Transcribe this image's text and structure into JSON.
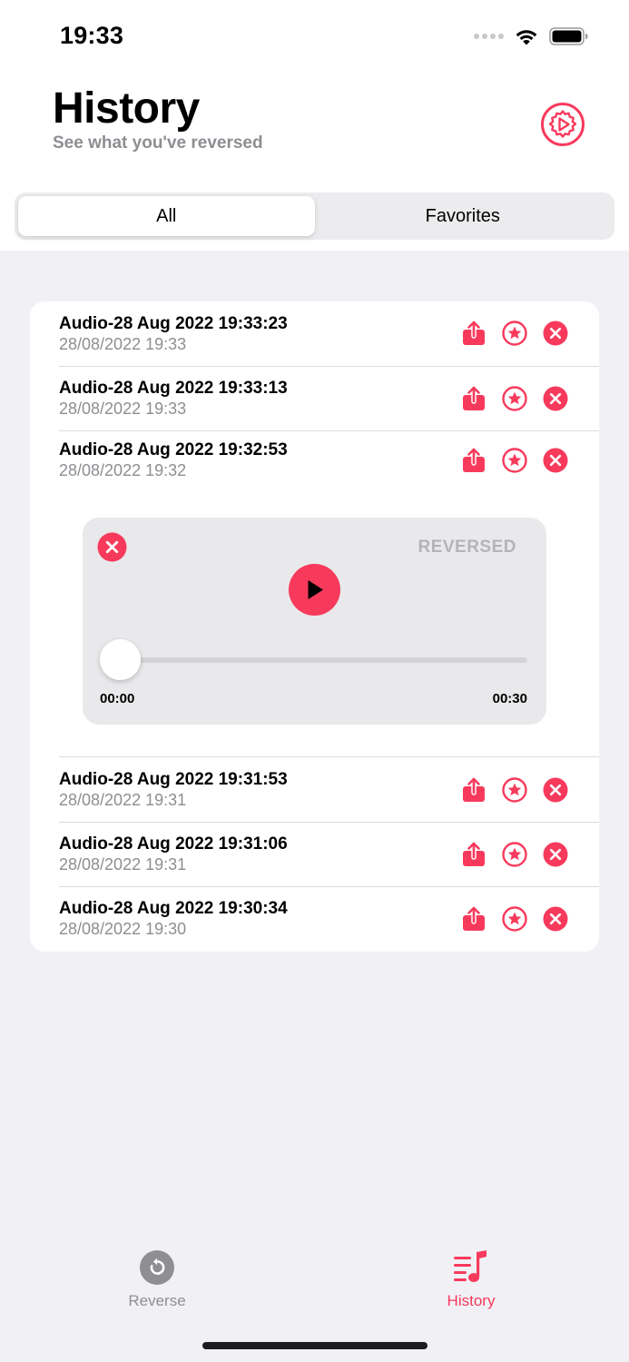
{
  "status_bar": {
    "time": "19:33"
  },
  "header": {
    "title": "History",
    "subtitle": "See what you've reversed"
  },
  "segmented": {
    "all_label": "All",
    "favorites_label": "Favorites",
    "selected": "All"
  },
  "recordings": [
    {
      "title": "Audio-28 Aug 2022 19:33:23",
      "date": "28/08/2022 19:33"
    },
    {
      "title": "Audio-28 Aug 2022 19:33:13",
      "date": "28/08/2022 19:33"
    },
    {
      "title": "Audio-28 Aug 2022 19:32:53",
      "date": "28/08/2022 19:32"
    },
    {
      "title": "Audio-28 Aug 2022 19:31:53",
      "date": "28/08/2022 19:31"
    },
    {
      "title": "Audio-28 Aug 2022 19:31:06",
      "date": "28/08/2022 19:31"
    },
    {
      "title": "Audio-28 Aug 2022 19:30:34",
      "date": "28/08/2022 19:30"
    }
  ],
  "player": {
    "label": "REVERSED",
    "current_time": "00:00",
    "duration": "00:30",
    "progress": 0
  },
  "tab_bar": {
    "reverse_label": "Reverse",
    "history_label": "History",
    "selected": "History"
  },
  "colors": {
    "accent": "#f73a5c",
    "background": "#f1f1f5",
    "secondary_text": "#8e8e93",
    "inactive_tab": "#8e8e93"
  },
  "icons": {
    "settings": "gear-play-icon",
    "share": "share-icon",
    "favorite": "star-circle-icon",
    "delete": "x-circle-icon",
    "play": "play-icon",
    "reverse_tab": "reverse-arrow-icon",
    "history_tab": "music-list-icon"
  }
}
